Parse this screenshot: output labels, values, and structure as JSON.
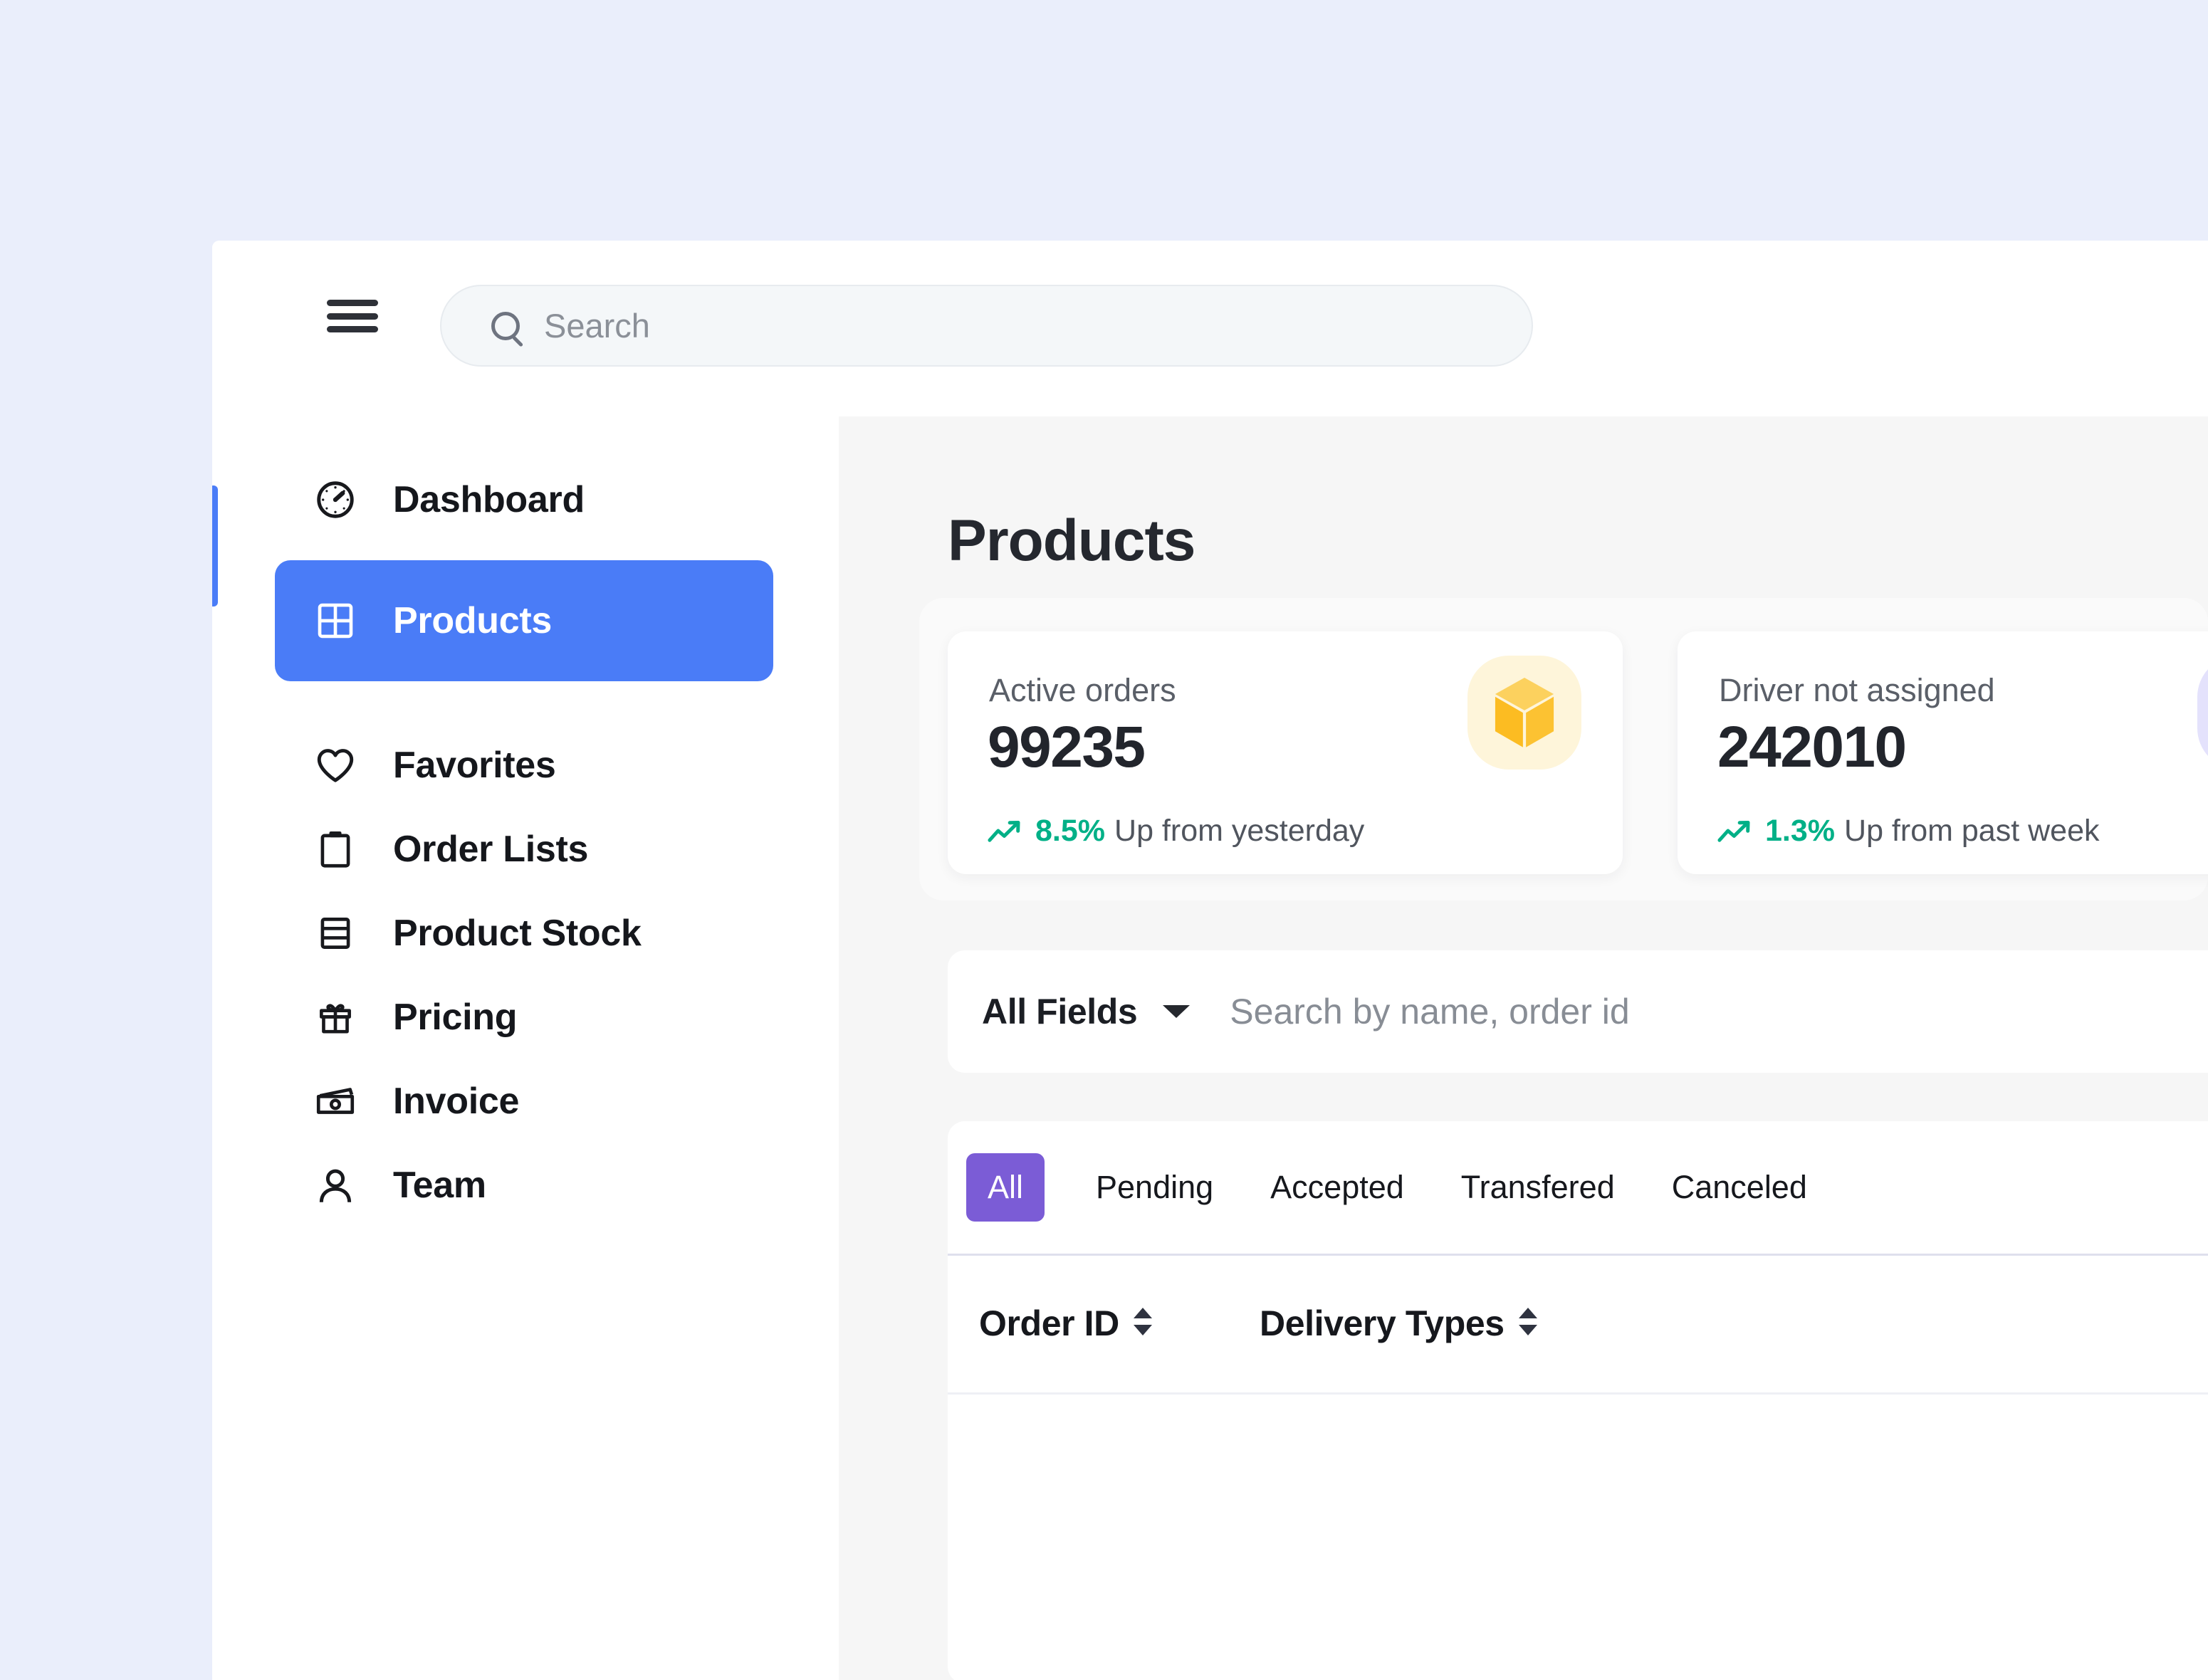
{
  "topbar": {
    "menu_icon": "hamburger-icon",
    "search": {
      "icon": "search-icon",
      "placeholder": "Search",
      "value": ""
    }
  },
  "sidebar": {
    "accent_color": "#4a7cf7",
    "active_color": "#4a7cf7",
    "items": [
      {
        "label": "Dashboard",
        "icon": "gauge-icon",
        "active": false
      },
      {
        "label": "Products",
        "icon": "grid-icon",
        "active": true
      },
      {
        "label": "Favorites",
        "icon": "heart-icon",
        "active": false
      },
      {
        "label": "Order Lists",
        "icon": "clipboard-icon",
        "active": false
      },
      {
        "label": "Product Stock",
        "icon": "rows-icon",
        "active": false
      },
      {
        "label": "Pricing",
        "icon": "gift-icon",
        "active": false
      },
      {
        "label": "Invoice",
        "icon": "banknote-icon",
        "active": false
      },
      {
        "label": "Team",
        "icon": "person-icon",
        "active": false
      }
    ]
  },
  "main": {
    "page_title": "Products",
    "stats": [
      {
        "label": "Active orders",
        "value": "99235",
        "trend_pct": "8.5%",
        "trend_text": "Up from yesterday",
        "trend_color": "#00b087",
        "icon": "box-icon",
        "icon_bg": "#fef5da",
        "icon_color": "#fcc02e"
      },
      {
        "label": "Driver not assigned",
        "value": "242010",
        "trend_pct": "1.3%",
        "trend_text": "Up from past week",
        "trend_color": "#00b087",
        "icon": "user-icon",
        "icon_bg": "#e4e2fc",
        "icon_color": "#6658e8"
      }
    ],
    "filter": {
      "field_label": "All Fields",
      "caret_icon": "caret-down-icon",
      "search_placeholder": "Search by name, order id",
      "search_value": ""
    },
    "status_tabs": [
      {
        "label": "All",
        "active": true
      },
      {
        "label": "Pending",
        "active": false
      },
      {
        "label": "Accepted",
        "active": false
      },
      {
        "label": "Transfered",
        "active": false
      },
      {
        "label": "Canceled",
        "active": false
      }
    ],
    "active_tab_color": "#7b5cd6",
    "table": {
      "columns": [
        {
          "label": "Order ID",
          "sort_icon": "sort-chevrons-icon"
        },
        {
          "label": "Delivery Types",
          "sort_icon": "sort-chevrons-icon"
        }
      ],
      "rows": []
    }
  }
}
